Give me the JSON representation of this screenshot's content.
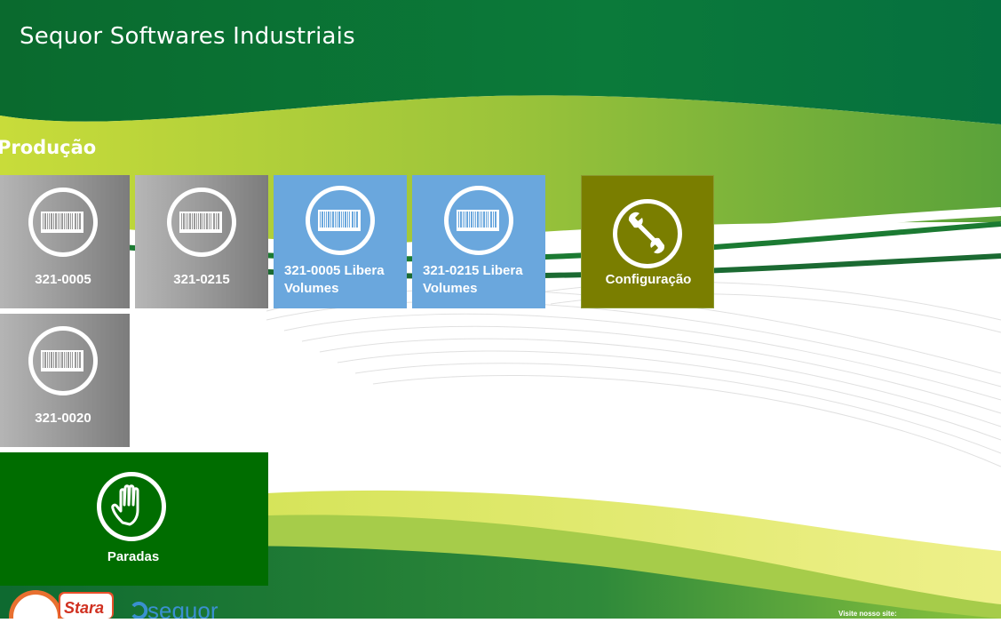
{
  "app": {
    "title": "Sequor Softwares Industriais"
  },
  "section": {
    "title": "Produção"
  },
  "tiles": [
    {
      "label": "321-0005",
      "icon": "barcode-icon",
      "color": "gray"
    },
    {
      "label": "321-0215",
      "icon": "barcode-icon",
      "color": "gray"
    },
    {
      "label": "321-0005 Libera Volumes",
      "icon": "barcode-icon",
      "color": "#6aa7dd"
    },
    {
      "label": "321-0215 Libera Volumes",
      "icon": "barcode-icon",
      "color": "#6aa7dd"
    },
    {
      "label": "Configuração",
      "icon": "wrench-icon",
      "color": "#7a7e00"
    },
    {
      "label": "321-0020",
      "icon": "barcode-icon",
      "color": "gray"
    },
    {
      "label": "Paradas",
      "icon": "hand-stop-icon",
      "color": "#006d00"
    }
  ],
  "footer": {
    "stara_logo": "Stara",
    "sequor_logo": "sequor",
    "visit_text": "Visite nosso site:"
  }
}
